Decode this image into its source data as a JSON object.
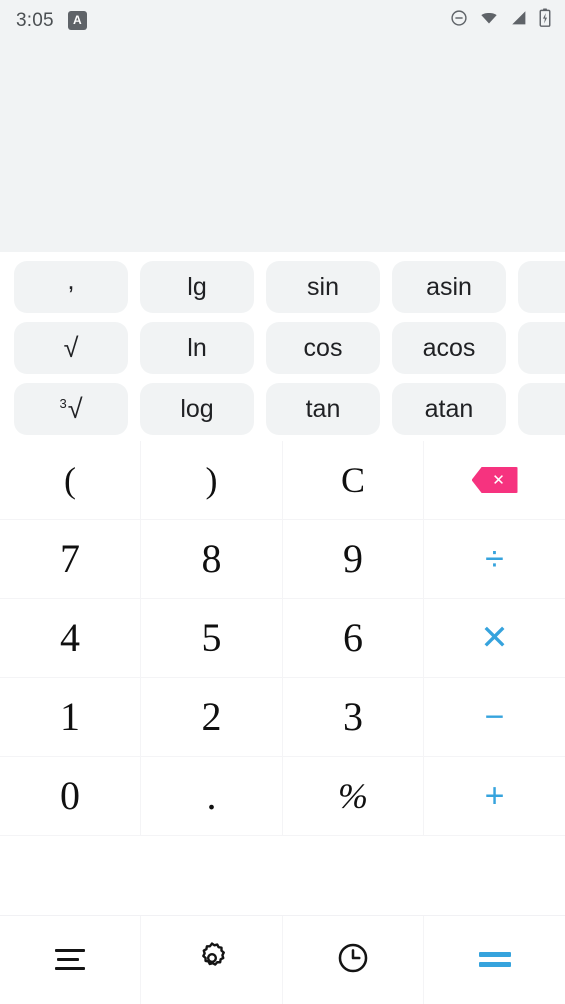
{
  "statusbar": {
    "time": "3:05",
    "app_badge_letter": "A",
    "icons": [
      "do-not-disturb-icon",
      "wifi-icon",
      "cell-signal-icon",
      "battery-charging-icon"
    ]
  },
  "display": {
    "expression": "",
    "result": ""
  },
  "scientific": {
    "rows": [
      [
        {
          "label": ",",
          "name": "comma"
        },
        {
          "label": "lg",
          "name": "lg"
        },
        {
          "label": "sin",
          "name": "sin"
        },
        {
          "label": "asin",
          "name": "asin"
        },
        {
          "label": "",
          "name": "hidden-1"
        }
      ],
      [
        {
          "label": "√",
          "name": "square-root"
        },
        {
          "label": "ln",
          "name": "ln"
        },
        {
          "label": "cos",
          "name": "cos"
        },
        {
          "label": "acos",
          "name": "acos"
        },
        {
          "label": "",
          "name": "hidden-2"
        }
      ],
      [
        {
          "label": "³√",
          "name": "cube-root"
        },
        {
          "label": "log",
          "name": "log"
        },
        {
          "label": "tan",
          "name": "tan"
        },
        {
          "label": "atan",
          "name": "atan"
        },
        {
          "label": "",
          "name": "hidden-3"
        }
      ]
    ],
    "cube_root_superscript": "3",
    "radical_glyph": "√"
  },
  "keypad": {
    "open_paren": "(",
    "close_paren": ")",
    "clear": "C",
    "backspace_glyph": "✕",
    "seven": "7",
    "eight": "8",
    "nine": "9",
    "divide": "÷",
    "four": "4",
    "five": "5",
    "six": "6",
    "multiply": "✕",
    "one": "1",
    "two": "2",
    "three": "3",
    "minus": "−",
    "zero": "0",
    "decimal": ".",
    "percent": "%",
    "plus": "+"
  },
  "bottombar": {
    "menu_label": "menu-icon",
    "settings_label": "gear-icon",
    "history_label": "clock-icon",
    "equals_label": "="
  },
  "colors": {
    "operator_blue": "#36a3dd",
    "backspace_pink": "#f6337f",
    "display_bg": "#f1f3f4",
    "chip_bg": "#f1f3f4",
    "key_text": "#101010"
  }
}
